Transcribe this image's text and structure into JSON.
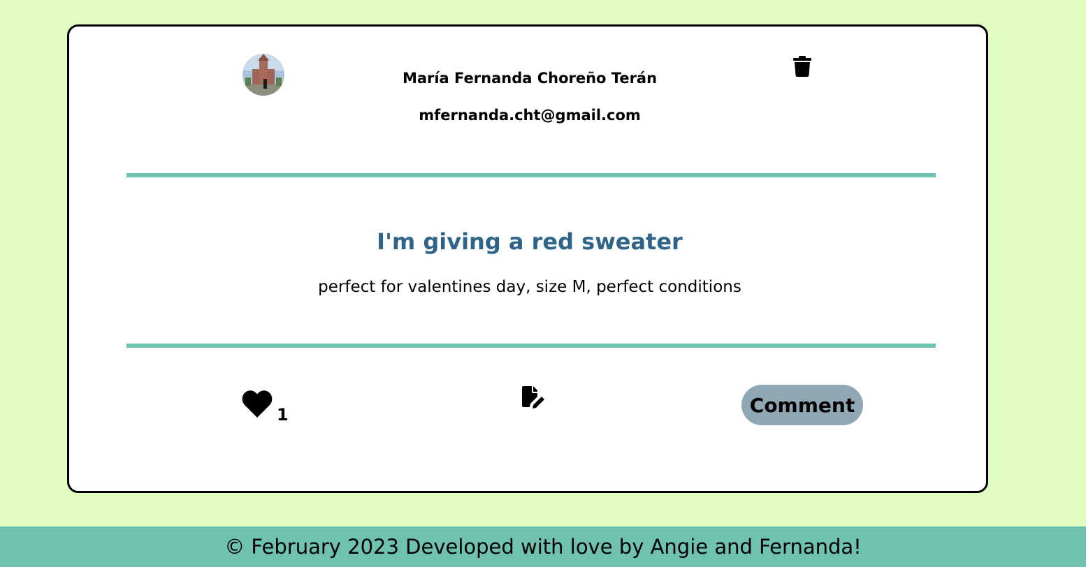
{
  "post": {
    "author_name": "María Fernanda Choreño Terán",
    "author_email": "mfernanda.cht@gmail.com",
    "avatar": "avatar-photo-icon",
    "title": "I'm giving a red sweater",
    "description": "perfect for valentines day, size M, perfect conditions",
    "likes": "1",
    "comment_label": "Comment",
    "icons": {
      "delete": "trash-icon",
      "like": "heart-icon",
      "edit": "edit-document-icon"
    }
  },
  "footer": {
    "text": "© February 2023 Developed with love by Angie and Fernanda!"
  },
  "colors": {
    "background": "#e1fcc0",
    "accent_divider": "#6fc3b1",
    "title": "#2e6488",
    "comment_button": "#8fa8b4",
    "footer_bg": "#6fc1b0"
  }
}
